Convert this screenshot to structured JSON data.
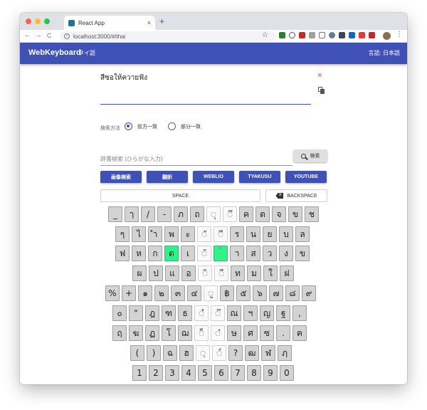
{
  "browser": {
    "tab_title": "React App",
    "tab_close": "×",
    "new_tab": "+",
    "url": "localhost:3000/#/thai",
    "back": "←",
    "forward": "→",
    "reload": "C",
    "info": "i",
    "star": "☆",
    "menu": "⋮"
  },
  "appbar": {
    "brand": "WebKeyboard",
    "language_link": "タイ語",
    "ui_language": "言語: 日本語",
    "color": "#3f51b5"
  },
  "editor": {
    "text": "สีซอให้ควายฟัง",
    "clear": "×"
  },
  "search": {
    "method_label": "検索方法",
    "options": [
      {
        "label": "前方一致",
        "selected": true
      },
      {
        "label": "部分一致",
        "selected": false
      }
    ],
    "placeholder": "辞書検索 (ひらがな入力)",
    "button_label": "検索"
  },
  "links": [
    "画像検索",
    "翻訳",
    "WEBLIO",
    "TYAKUSU",
    "YOUTUBE"
  ],
  "controls": {
    "space": "SPACE",
    "backspace": "BACKSPACE"
  },
  "keyboard": {
    "rows": [
      [
        {
          "c": "_"
        },
        {
          "c": "ๅ"
        },
        {
          "c": "/"
        },
        {
          "c": "-"
        },
        {
          "c": "ภ"
        },
        {
          "c": "ถ"
        },
        {
          "c": "ุ",
          "w": true
        },
        {
          "c": "ึ",
          "w": true
        },
        {
          "c": "ค"
        },
        {
          "c": "ต"
        },
        {
          "c": "จ"
        },
        {
          "c": "ข"
        },
        {
          "c": "ช"
        }
      ],
      [
        {
          "c": "ๆ"
        },
        {
          "c": "ไ"
        },
        {
          "c": "ำ"
        },
        {
          "c": "พ"
        },
        {
          "c": "ะ"
        },
        {
          "c": "ั",
          "w": true
        },
        {
          "c": "ี",
          "w": true
        },
        {
          "c": "ร"
        },
        {
          "c": "น"
        },
        {
          "c": "ย"
        },
        {
          "c": "บ"
        },
        {
          "c": "ล"
        }
      ],
      [
        {
          "c": "ฟ"
        },
        {
          "c": "ห"
        },
        {
          "c": "ก"
        },
        {
          "c": "ด",
          "g": true
        },
        {
          "c": "เ"
        },
        {
          "c": "้",
          "w": true
        },
        {
          "c": "่",
          "g": true
        },
        {
          "c": "า"
        },
        {
          "c": "ส"
        },
        {
          "c": "ว"
        },
        {
          "c": "ง"
        },
        {
          "c": "ข"
        }
      ],
      [
        {
          "c": "ผ"
        },
        {
          "c": "ป"
        },
        {
          "c": "แ"
        },
        {
          "c": "อ"
        },
        {
          "c": "ิ",
          "w": true
        },
        {
          "c": "ื",
          "w": true
        },
        {
          "c": "ท"
        },
        {
          "c": "ม"
        },
        {
          "c": "ใ"
        },
        {
          "c": "ฝ"
        }
      ],
      [
        {
          "c": "%"
        },
        {
          "c": "+"
        },
        {
          "c": "๑"
        },
        {
          "c": "๒"
        },
        {
          "c": "๓"
        },
        {
          "c": "๔"
        },
        {
          "c": "ู",
          "w": true
        },
        {
          "c": "฿"
        },
        {
          "c": "๕"
        },
        {
          "c": "๖"
        },
        {
          "c": "๗"
        },
        {
          "c": "๘"
        },
        {
          "c": "๙"
        }
      ],
      [
        {
          "c": "๐"
        },
        {
          "c": "\""
        },
        {
          "c": "ฎ"
        },
        {
          "c": "ฑ"
        },
        {
          "c": "ธ"
        },
        {
          "c": "ํ",
          "w": true
        },
        {
          "c": "๊",
          "w": true
        },
        {
          "c": "ณ"
        },
        {
          "c": "ฯ"
        },
        {
          "c": "ญ"
        },
        {
          "c": "ฐ"
        },
        {
          "c": ","
        }
      ],
      [
        {
          "c": "ฤ"
        },
        {
          "c": "ฆ"
        },
        {
          "c": "ฏ"
        },
        {
          "c": "โ"
        },
        {
          "c": "ฌ"
        },
        {
          "c": "็",
          "w": true
        },
        {
          "c": "๋",
          "w": true
        },
        {
          "c": "ษ"
        },
        {
          "c": "ศ"
        },
        {
          "c": "ซ"
        },
        {
          "c": "."
        },
        {
          "c": "ฅ"
        }
      ],
      [
        {
          "c": "("
        },
        {
          "c": ")"
        },
        {
          "c": "ฉ"
        },
        {
          "c": "ฮ"
        },
        {
          "c": "ฺ",
          "w": true
        },
        {
          "c": "์",
          "w": true
        },
        {
          "c": "?"
        },
        {
          "c": "ฒ"
        },
        {
          "c": "ฬ"
        },
        {
          "c": "ฦ"
        }
      ],
      [
        {
          "c": "1"
        },
        {
          "c": "2"
        },
        {
          "c": "3"
        },
        {
          "c": "4"
        },
        {
          "c": "5"
        },
        {
          "c": "6"
        },
        {
          "c": "7"
        },
        {
          "c": "8"
        },
        {
          "c": "9"
        },
        {
          "c": "0"
        }
      ]
    ]
  }
}
